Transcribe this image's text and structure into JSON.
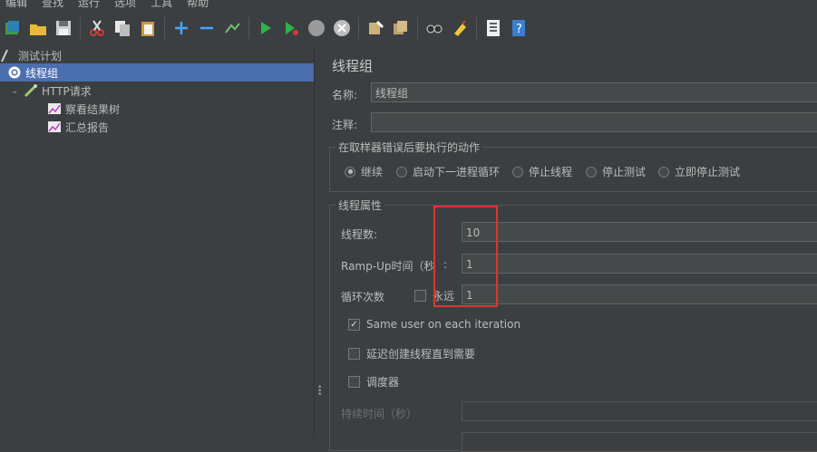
{
  "menu": [
    "编辑",
    "查找",
    "运行",
    "选项",
    "工具",
    "帮助"
  ],
  "toolbar_icons": [
    "templates-icon",
    "open-icon",
    "save-icon",
    "cut-icon",
    "copy-icon",
    "paste-icon",
    "add-icon",
    "remove-icon",
    "toggle-icon",
    "start-icon",
    "start-no-pause-icon",
    "stop-icon",
    "shutdown-icon",
    "clear-icon",
    "clear-all-icon",
    "search-icon",
    "reset-search-icon",
    "function-helper-icon",
    "help-icon"
  ],
  "tree": {
    "root": "测试计划",
    "thread_group": "线程组",
    "sampler": "HTTP请求",
    "listener1": "察看结果树",
    "listener2": "汇总报告"
  },
  "panel": {
    "title": "线程组",
    "name_label": "名称:",
    "name_value": "线程组",
    "comment_label": "注释:",
    "comment_value": "",
    "action_group_title": "在取样器错误后要执行的动作",
    "actions": [
      "继续",
      "启动下一进程循环",
      "停止线程",
      "停止测试",
      "立即停止测试"
    ],
    "selected_action": "继续",
    "props_title": "线程属性",
    "threads_label": "线程数:",
    "threads_value": "10",
    "rampup_label": "Ramp-Up时间（秒",
    "rampup_colon": ":",
    "rampup_value": "1",
    "loop_label": "循环次数",
    "forever_label": "永远",
    "loop_value": "1",
    "same_user_label": "Same user on each iteration",
    "same_user_checked": true,
    "delay_label": "延迟创建线程直到需要",
    "scheduler_label": "调度器",
    "duration_label": "持续时间（秒）"
  },
  "colors": {
    "selection": "#4b6eaf",
    "highlight": "#e0352b"
  }
}
